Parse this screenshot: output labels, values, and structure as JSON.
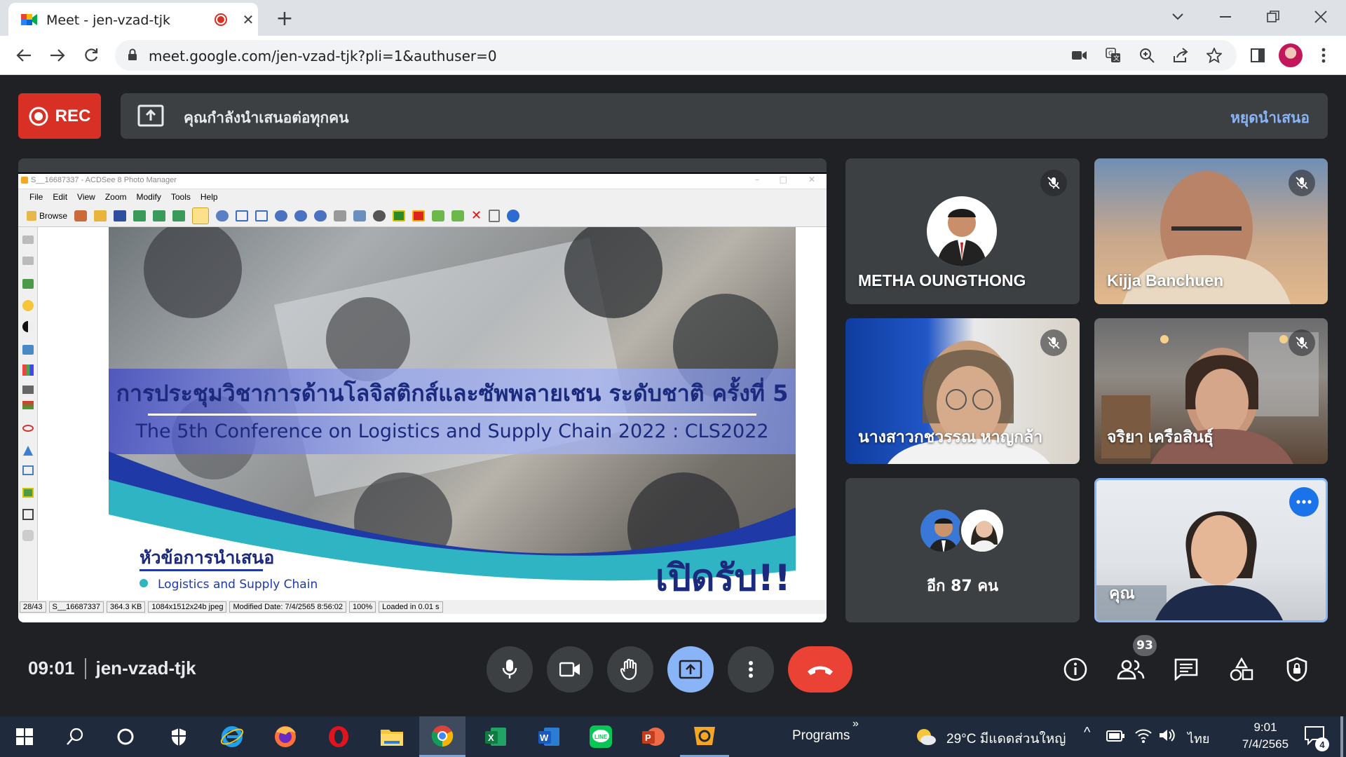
{
  "browser": {
    "tab_title": "Meet - jen-vzad-tjk",
    "new_tab": "+",
    "url": "meet.google.com/jen-vzad-tjk?pli=1&authuser=0"
  },
  "meet": {
    "rec_label": "REC",
    "presenting_text": "คุณกำลังนำเสนอต่อทุกคน",
    "stop_presenting": "หยุดนำเสนอ",
    "time": "09:01",
    "meeting_code": "jen-vzad-tjk",
    "participant_count": "93",
    "participants": [
      {
        "name": "METHA OUNGTHONG"
      },
      {
        "name": "Kijja Banchuen"
      },
      {
        "name": "นางสาวกชวรรณ หาญกล้า"
      },
      {
        "name": "จริยา เครือสินธุ์"
      },
      {
        "name": "อีก 87 คน"
      },
      {
        "name": "คุณ"
      }
    ]
  },
  "acdsee": {
    "title": "S__16687337 - ACDSee 8 Photo Manager",
    "menu": [
      "File",
      "Edit",
      "View",
      "Zoom",
      "Modify",
      "Tools",
      "Help"
    ],
    "browse_label": "Browse",
    "status": [
      "28/43",
      "S__16687337",
      "364.3 KB",
      "1084x1512x24b jpeg",
      "Modified Date: 7/4/2565 8:56:02",
      "100%",
      "Loaded in 0.01 s"
    ]
  },
  "slide": {
    "title_th": "การประชุมวิชาการด้านโลจิสติกส์และซัพพลายเชน ระดับชาติ ครั้งที่ 5",
    "title_en": "The 5th Conference on Logistics and Supply Chain 2022 : CLS2022",
    "topic_heading": "หัวข้อการนำเสนอ",
    "topic_item": "Logistics and Supply Chain",
    "open_label": "เปิดรับ!!"
  },
  "taskbar": {
    "programs": "Programs",
    "weather": "29°C  มีแดดส่วนใหญ่",
    "lang": "ไทย",
    "clock_time": "9:01",
    "clock_date": "7/4/2565",
    "notif_count": "4"
  },
  "colors": {
    "meet_bg": "#202124",
    "tile_bg": "#3c4043",
    "rec_red": "#d93025",
    "accent_blue": "#8ab4f8",
    "present_blue": "#8ab4f8",
    "taskbar": "#1f2b3d"
  }
}
